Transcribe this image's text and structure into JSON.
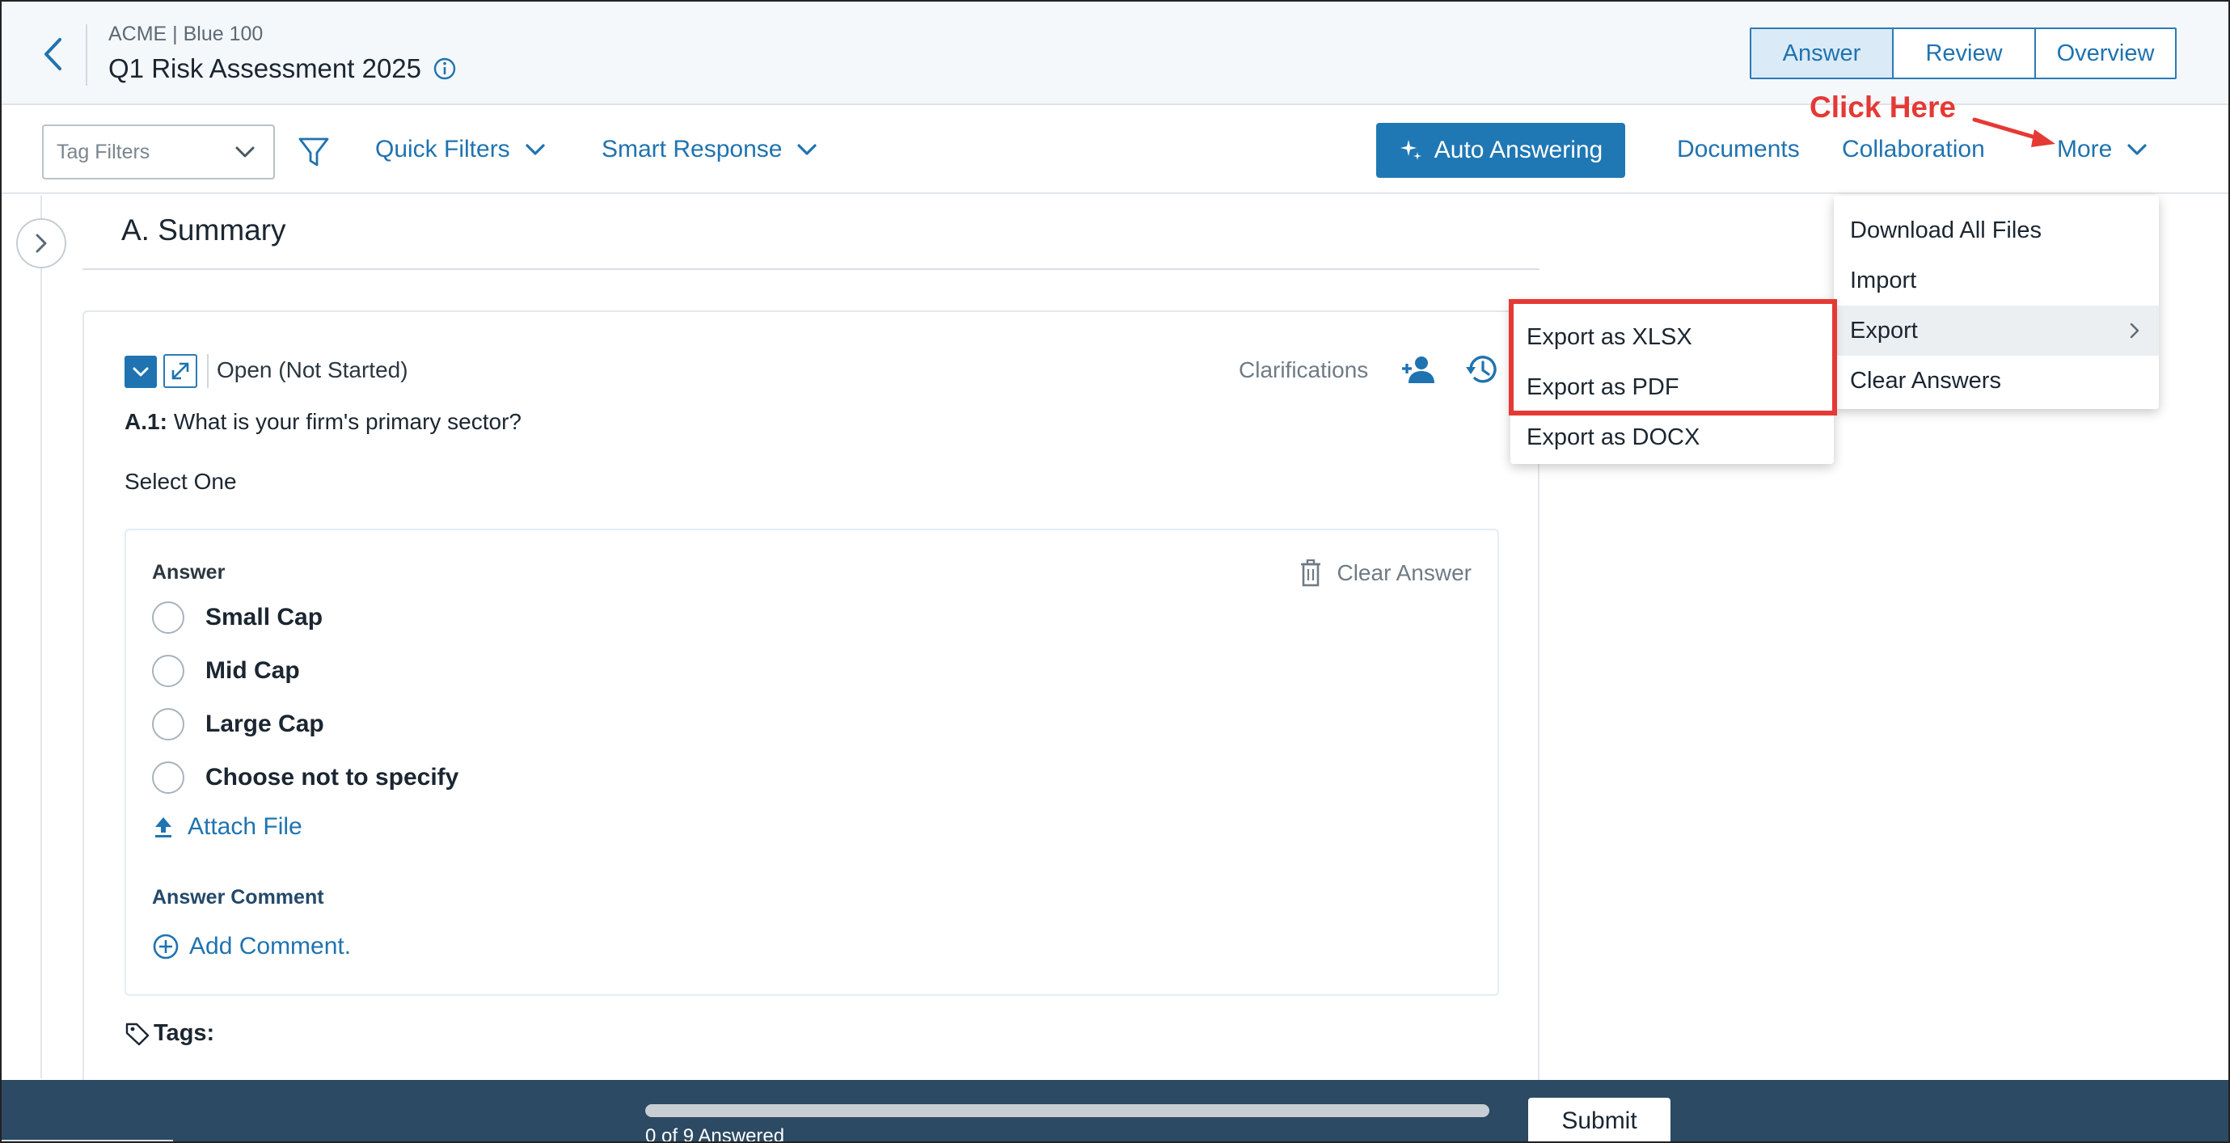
{
  "header": {
    "breadcrumb": "ACME | Blue 100",
    "title": "Q1 Risk Assessment 2025",
    "tabs": [
      {
        "label": "Answer",
        "active": true
      },
      {
        "label": "Review",
        "active": false
      },
      {
        "label": "Overview",
        "active": false
      }
    ]
  },
  "toolbar": {
    "tag_filter_placeholder": "Tag Filters",
    "quick_filters": "Quick Filters",
    "smart_response": "Smart Response",
    "auto_answering": "Auto Answering",
    "documents": "Documents",
    "collaboration": "Collaboration",
    "more": "More"
  },
  "annotation": {
    "click_here": "Click Here",
    "color": "#e53935"
  },
  "section": {
    "title": "A. Summary"
  },
  "question": {
    "status": "Open (Not Started)",
    "clarifications": "Clarifications",
    "number": "A.1:",
    "text": "What is your firm's primary sector?",
    "instruction": "Select One",
    "answer_label": "Answer",
    "clear_answer": "Clear Answer",
    "options": [
      "Small Cap",
      "Mid Cap",
      "Large Cap",
      "Choose not to specify"
    ],
    "attach_file": "Attach File",
    "comment_label": "Answer Comment",
    "add_comment": "Add Comment.",
    "tags_label": "Tags:"
  },
  "more_menu": {
    "items": [
      "Download All Files",
      "Import",
      "Export",
      "Clear Answers"
    ],
    "active_item": "Export"
  },
  "export_menu": {
    "items": [
      "Export as XLSX",
      "Export as PDF",
      "Export as DOCX"
    ]
  },
  "footer": {
    "progress_label": "0 of 9 Answered",
    "answered": 0,
    "total": 9,
    "submit": "Submit"
  },
  "colors": {
    "primary": "#1f73b0",
    "footer_bg": "#2c4a63",
    "highlight": "#e53935"
  }
}
